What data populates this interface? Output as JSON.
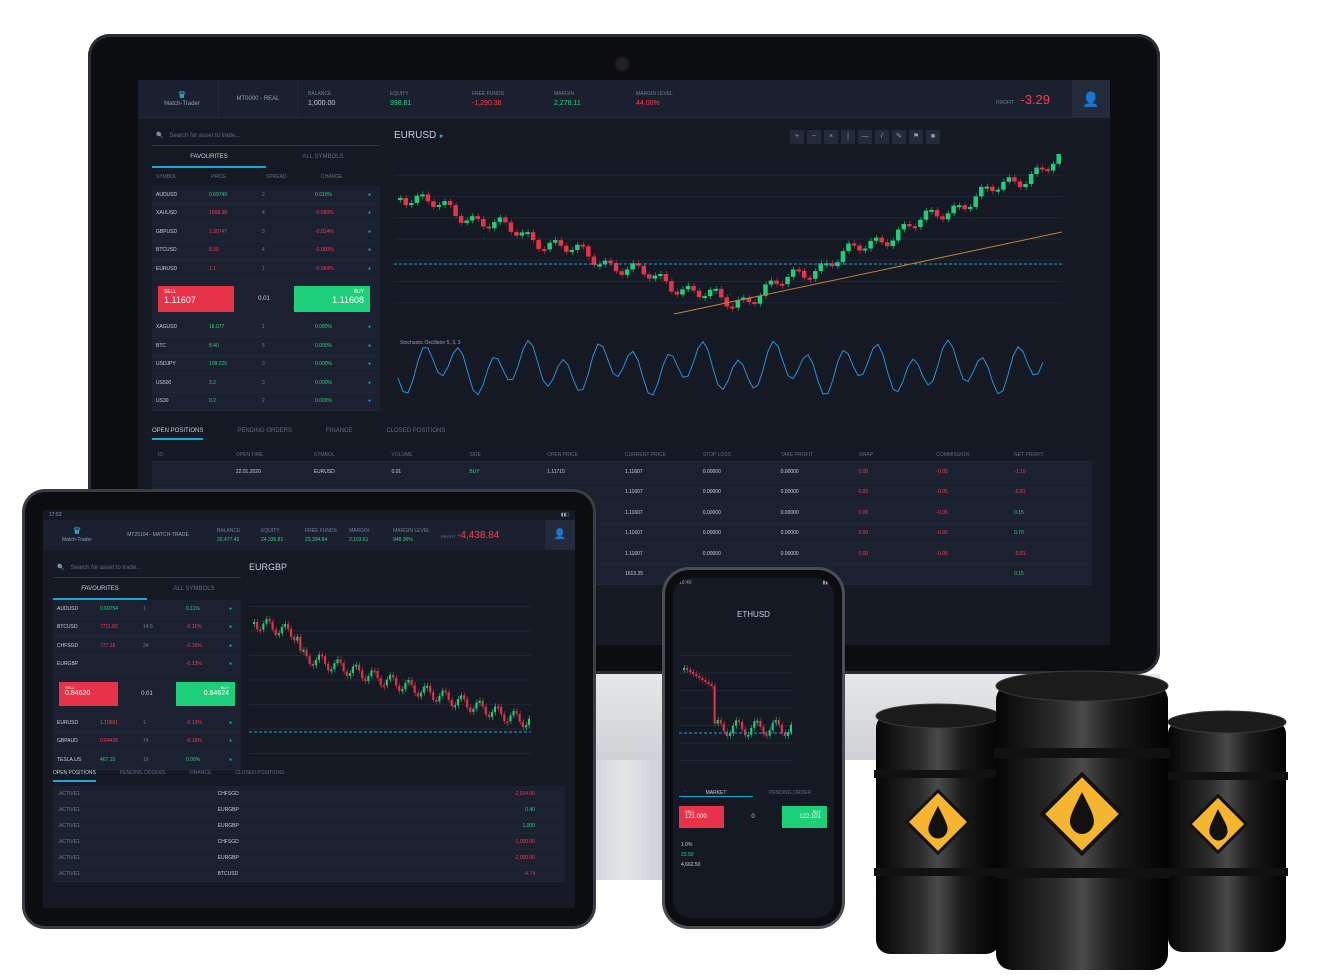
{
  "desktop": {
    "brand": "Match-Trader",
    "account": "MT0000 - REAL",
    "stats": [
      {
        "label": "BALANCE",
        "value": "1,000.00"
      },
      {
        "label": "EQUITY",
        "value": "998.81"
      },
      {
        "label": "FREE FUNDS",
        "value": "-1,290.38"
      },
      {
        "label": "MARGIN",
        "value": "2,278.11"
      },
      {
        "label": "MARGIN LEVEL",
        "value": "44.00%"
      }
    ],
    "profit_label": "PROFIT",
    "profit_value": "-3.29",
    "search_placeholder": "Search for asset to trade...",
    "tab_favourites": "FAVOURITES",
    "tab_all_symbols": "ALL SYMBOLS",
    "columns": [
      "SYMBOL",
      "PRICE",
      "SPREAD",
      "CHANGE"
    ],
    "symbols": [
      {
        "name": "AUDUSD",
        "price": "0.69749",
        "spread": "2",
        "change": "0.010%",
        "dir": "up"
      },
      {
        "name": "XAUUSD",
        "price": "1568.38",
        "spread": "4",
        "change": "-0.080%",
        "dir": "down"
      },
      {
        "name": "GBPUSD",
        "price": "1.30747",
        "spread": "3",
        "change": "-0.014%",
        "dir": "down"
      },
      {
        "name": "BTCUSD",
        "price": "8.39",
        "spread": "4",
        "change": "-0.000%",
        "dir": "down"
      },
      {
        "name": "EURUSD",
        "price": "1.1",
        "spread": "1",
        "change": "-0.064%",
        "dir": "down"
      }
    ],
    "symbols_after": [
      {
        "name": "XAGUSD",
        "price": "18.077",
        "spread": "1",
        "change": "0.080%",
        "dir": "up"
      },
      {
        "name": "BTC",
        "price": "8.40",
        "spread": "5",
        "change": "0.000%",
        "dir": "up"
      },
      {
        "name": "USDJPY",
        "price": "108.225",
        "spread": "3",
        "change": "0.000%",
        "dir": "up"
      },
      {
        "name": "US500",
        "price": "3.2",
        "spread": "3",
        "change": "0.000%",
        "dir": "up"
      },
      {
        "name": "US30",
        "price": "0.2",
        "spread": "2",
        "change": "0.000%",
        "dir": "up"
      }
    ],
    "sell_label": "SELL",
    "sell_price": "1.11607",
    "buy_label": "BUY",
    "buy_price": "1.11608",
    "qty": "0.01",
    "chart_symbol": "EURUSD",
    "oscillator_label": "Stochastic Oscillator 5, 3, 3",
    "position_tabs": [
      "OPEN POSITIONS",
      "PENDING ORDERS",
      "FINANCE",
      "CLOSED POSITIONS"
    ],
    "position_columns": [
      "ID",
      "OPEN TIME",
      "SYMBOL",
      "VOLUME",
      "SIDE",
      "OPEN PRICE",
      "CURRENT PRICE",
      "STOP LOSS",
      "TAKE PROFIT",
      "SWAP",
      "COMMISSION",
      "NET PROFIT"
    ],
    "positions": [
      {
        "time": "22.01.2020",
        "symbol": "EURUSD",
        "volume": "0.01",
        "side": "BUY",
        "open": "1.11715",
        "current": "1.11607",
        "sl": "0.00000",
        "tp": "0.00000",
        "swap": "0.00",
        "comm": "-0.05",
        "net": "-1.10"
      },
      {
        "time": "",
        "symbol": "",
        "volume": "",
        "side": "",
        "open": "",
        "current": "1.11607",
        "sl": "0.00000",
        "tp": "0.00000",
        "swap": "0.00",
        "comm": "-0.05",
        "net": "-0.81"
      },
      {
        "time": "",
        "symbol": "",
        "volume": "",
        "side": "",
        "open": "",
        "current": "1.11607",
        "sl": "0.00000",
        "tp": "0.00000",
        "swap": "0.00",
        "comm": "-0.05",
        "net": "0.15"
      },
      {
        "time": "",
        "symbol": "",
        "volume": "",
        "side": "",
        "open": "",
        "current": "1.11607",
        "sl": "0.00000",
        "tp": "0.00000",
        "swap": "0.00",
        "comm": "-0.05",
        "net": "0.70"
      },
      {
        "time": "",
        "symbol": "",
        "volume": "",
        "side": "",
        "open": "",
        "current": "1.11607",
        "sl": "0.00000",
        "tp": "0.00000",
        "swap": "0.00",
        "comm": "-0.05",
        "net": "-0.81"
      },
      {
        "time": "",
        "symbol": "",
        "volume": "",
        "side": "",
        "open": "",
        "current": "1613.25",
        "sl": "",
        "tp": "",
        "swap": "",
        "comm": "",
        "net": "0.15"
      }
    ]
  },
  "tablet": {
    "time": "17:53",
    "brand": "Match-Trader",
    "account": "MT25104 - MATCH-TRADE",
    "stats": [
      {
        "label": "BALANCE",
        "value": "20,477.46"
      },
      {
        "label": "EQUITY",
        "value": "24,336.81"
      },
      {
        "label": "FREE FUNDS",
        "value": "23,394.84"
      },
      {
        "label": "MARGIN",
        "value": "2,103.61"
      },
      {
        "label": "MARGIN LEVEL",
        "value": "948.36%"
      }
    ],
    "profit_label": "PROFIT",
    "profit_value": "-4,438.84",
    "search_placeholder": "Search for asset to trade...",
    "tab_favourites": "FAVOURITES",
    "tab_all_symbols": "ALL SYMBOLS",
    "chart_symbol": "EURGBP",
    "symbols": [
      {
        "name": "AUDUSD",
        "price": "0.69754",
        "spread": "1",
        "change": "0.11%",
        "dir": "up"
      },
      {
        "name": "BTCUSD",
        "price": "7711.83",
        "spread": "14.5",
        "change": "-0.11%",
        "dir": "down"
      },
      {
        "name": "CHFSGD",
        "price": "777.18",
        "spread": "24",
        "change": "-0.16%",
        "dir": "down"
      },
      {
        "name": "EURGBP",
        "price": "",
        "spread": "",
        "change": "-0.13%",
        "dir": "down"
      },
      {
        "name": "EURUSD",
        "price": "1.10601",
        "spread": "1",
        "change": "-0.13%",
        "dir": "down"
      },
      {
        "name": "GBPAUD",
        "price": "0.64426",
        "spread": "74",
        "change": "-0.15%",
        "dir": "down"
      },
      {
        "name": "TESLA.US",
        "price": "467.15",
        "spread": "19",
        "change": "0.00%",
        "dir": "up"
      }
    ],
    "sell_label": "SELL",
    "sell_price": "0.84620",
    "buy_label": "BUY",
    "buy_price": "0.84624",
    "qty": "0.01",
    "position_tabs": [
      "OPEN POSITIONS",
      "PENDING ORDERS",
      "FINANCE",
      "CLOSED POSITIONS"
    ],
    "positions": [
      {
        "id": "ACTIVE1",
        "symbol": "CHFSGD",
        "net": "-2,014.00"
      },
      {
        "id": "ACTIVE1",
        "symbol": "EURGBP",
        "net": "0.40"
      },
      {
        "id": "ACTIVE1",
        "symbol": "EURGBP",
        "net": "1,000"
      },
      {
        "id": "ACTIVE1",
        "symbol": "CHFSGD",
        "net": "-1,000.00"
      },
      {
        "id": "ACTIVE1",
        "symbol": "EURGBP",
        "net": "-2,000.00"
      },
      {
        "id": "ACTIVE1",
        "symbol": "BTCUSD",
        "net": "-4.74"
      }
    ]
  },
  "phone": {
    "time": "10:40",
    "chart_symbol": "ETHUSD",
    "tabs": [
      "MARKET",
      "PENDING ORDER"
    ],
    "sell_label": "SELL",
    "sell_price": "121.000",
    "buy_label": "BUY",
    "buy_price": "122.101",
    "qty": "0",
    "stats": [
      "1.0%",
      "23.50",
      "4,662.50"
    ]
  },
  "colors": {
    "up": "#1ccf78",
    "down": "#ff3b4b",
    "accent": "#1aa9d6",
    "bg": "#141923"
  }
}
